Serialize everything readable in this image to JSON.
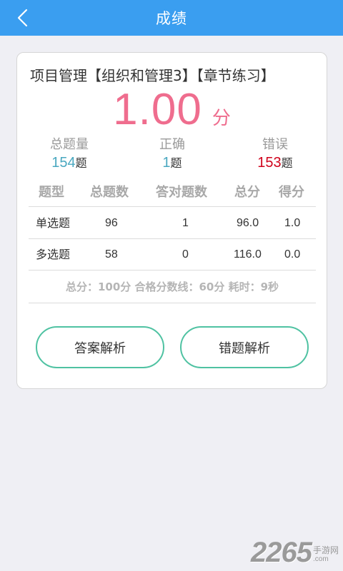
{
  "header": {
    "title": "成绩",
    "back_icon": "chevron-left-icon"
  },
  "card": {
    "title": "项目管理【组织和管理3】【章节练习】",
    "score": {
      "value": "1.00",
      "unit": "分",
      "color": "#ef6d8e"
    },
    "stats": [
      {
        "label": "总题量",
        "value": "154",
        "suffix": "题",
        "color": "#4aa8c0"
      },
      {
        "label": "正确",
        "value": "1",
        "suffix": "题",
        "color": "#4aa8c0"
      },
      {
        "label": "错误",
        "value": "153",
        "suffix": "题",
        "color": "#d0021b"
      }
    ],
    "table": {
      "headers": [
        "题型",
        "总题数",
        "答对题数",
        "总分",
        "得分"
      ],
      "rows": [
        [
          "单选题",
          "96",
          "1",
          "96.0",
          "1.0"
        ],
        [
          "多选题",
          "58",
          "0",
          "116.0",
          "0.0"
        ]
      ]
    },
    "summary": "总分：100分 合格分数线：60分 耗时：9秒",
    "buttons": {
      "answer_analysis": "答案解析",
      "wrong_analysis": "错题解析"
    }
  },
  "watermark": {
    "number": "2265",
    "cn": "手游网",
    "en": ".com"
  },
  "colors": {
    "header_bg": "#3a9ef0",
    "accent_button_border": "#4fc2a2",
    "background": "#efeff4"
  }
}
